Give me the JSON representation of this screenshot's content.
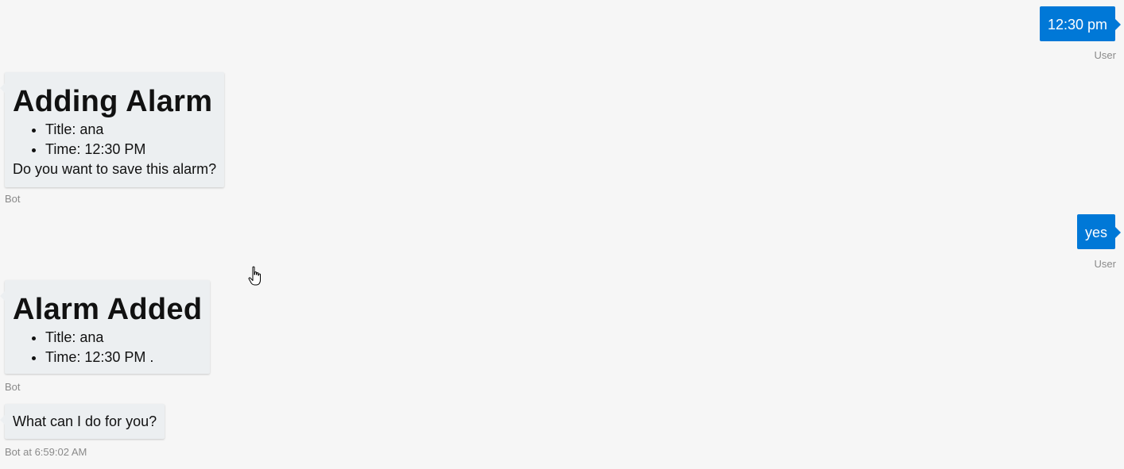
{
  "messages": [
    {
      "sender": "user",
      "text": "12:30 pm",
      "meta": "User"
    },
    {
      "sender": "bot",
      "card": {
        "title": "Adding Alarm",
        "items": [
          "Title: ana",
          "Time: 12:30 PM"
        ],
        "text": "Do you want to save this alarm?"
      },
      "meta": "Bot"
    },
    {
      "sender": "user",
      "text": "yes",
      "meta": "User"
    },
    {
      "sender": "bot",
      "card": {
        "title": "Alarm Added",
        "items": [
          "Title: ana",
          "Time: 12:30 PM ."
        ]
      },
      "meta": "Bot"
    },
    {
      "sender": "bot",
      "text": "What can I do for you?",
      "meta": "Bot at 6:59:02 AM"
    }
  ],
  "colors": {
    "background": "#f6f6f6",
    "user_bubble": "#0078d7",
    "bot_bubble": "#eceff1",
    "meta_text": "#8a8a8a"
  },
  "icons": {
    "cursor": "hand-pointer-icon"
  }
}
